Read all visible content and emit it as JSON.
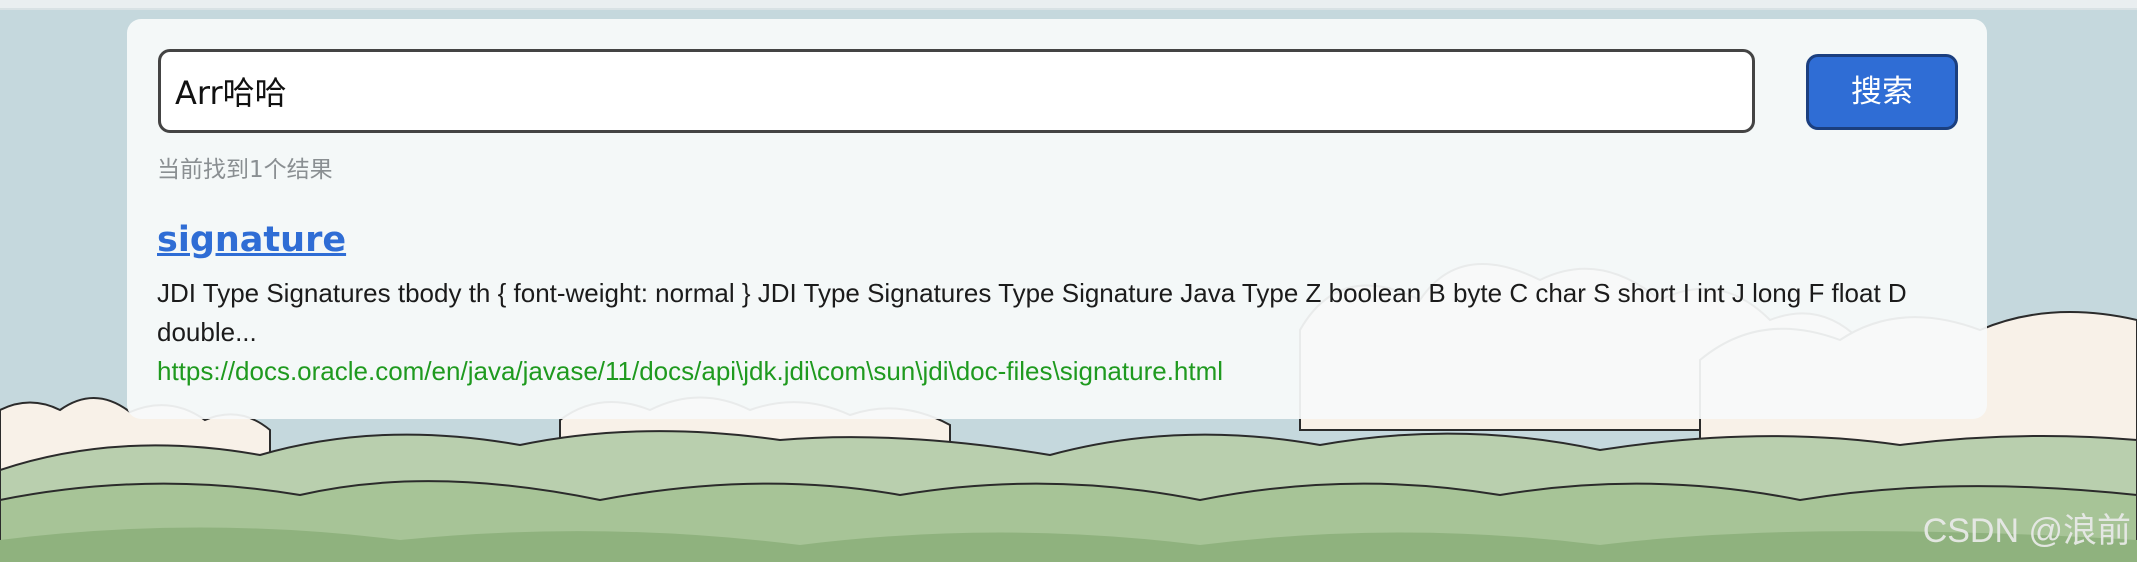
{
  "search": {
    "value": "Arr哈哈",
    "button_label": "搜索"
  },
  "results_summary": "当前找到1个结果",
  "results": [
    {
      "title": "signature",
      "snippet": "JDI Type Signatures tbody th { font-weight: normal } JDI Type Signatures Type Signature Java Type Z boolean B byte C char S short I int J long F float D double...",
      "url": "https://docs.oracle.com/en/java/javase/11/docs/api\\jdk.jdi\\com\\sun\\jdi\\doc-files\\signature.html"
    }
  ],
  "watermark": "CSDN @浪前",
  "colors": {
    "accent": "#2f6dd5",
    "url": "#1f9a1f",
    "panel": "#f7fafa",
    "sky": "#c5d8dd",
    "hills": "#9dbb8d"
  }
}
